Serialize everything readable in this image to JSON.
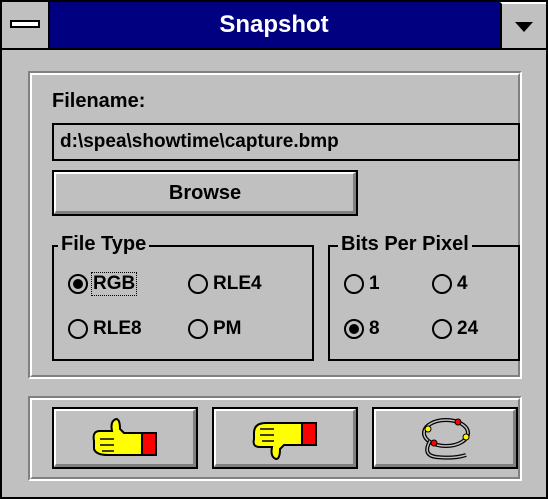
{
  "window": {
    "title": "Snapshot",
    "system_menu_icon": "system-menu-bar-icon",
    "minimize_icon": "triangle-down-icon"
  },
  "filename": {
    "label": "Filename:",
    "value": "d:\\spea\\showtime\\capture.bmp"
  },
  "browse_label": "Browse",
  "file_type": {
    "title": "File Type",
    "options": [
      "RGB",
      "RLE4",
      "RLE8",
      "PM"
    ],
    "selected": "RGB"
  },
  "bits_per_pixel": {
    "title": "Bits Per Pixel",
    "options": [
      "1",
      "4",
      "8",
      "24"
    ],
    "selected": "8"
  },
  "actions": {
    "ok_icon": "hand-thumbs-up-icon",
    "cancel_icon": "hand-thumbs-down-icon",
    "help_icon": "lasso-rope-icon"
  },
  "colors": {
    "titlebar": "#000080",
    "face": "#c0c0c0",
    "hand": "#ffff00",
    "cuff": "#ff0000"
  }
}
